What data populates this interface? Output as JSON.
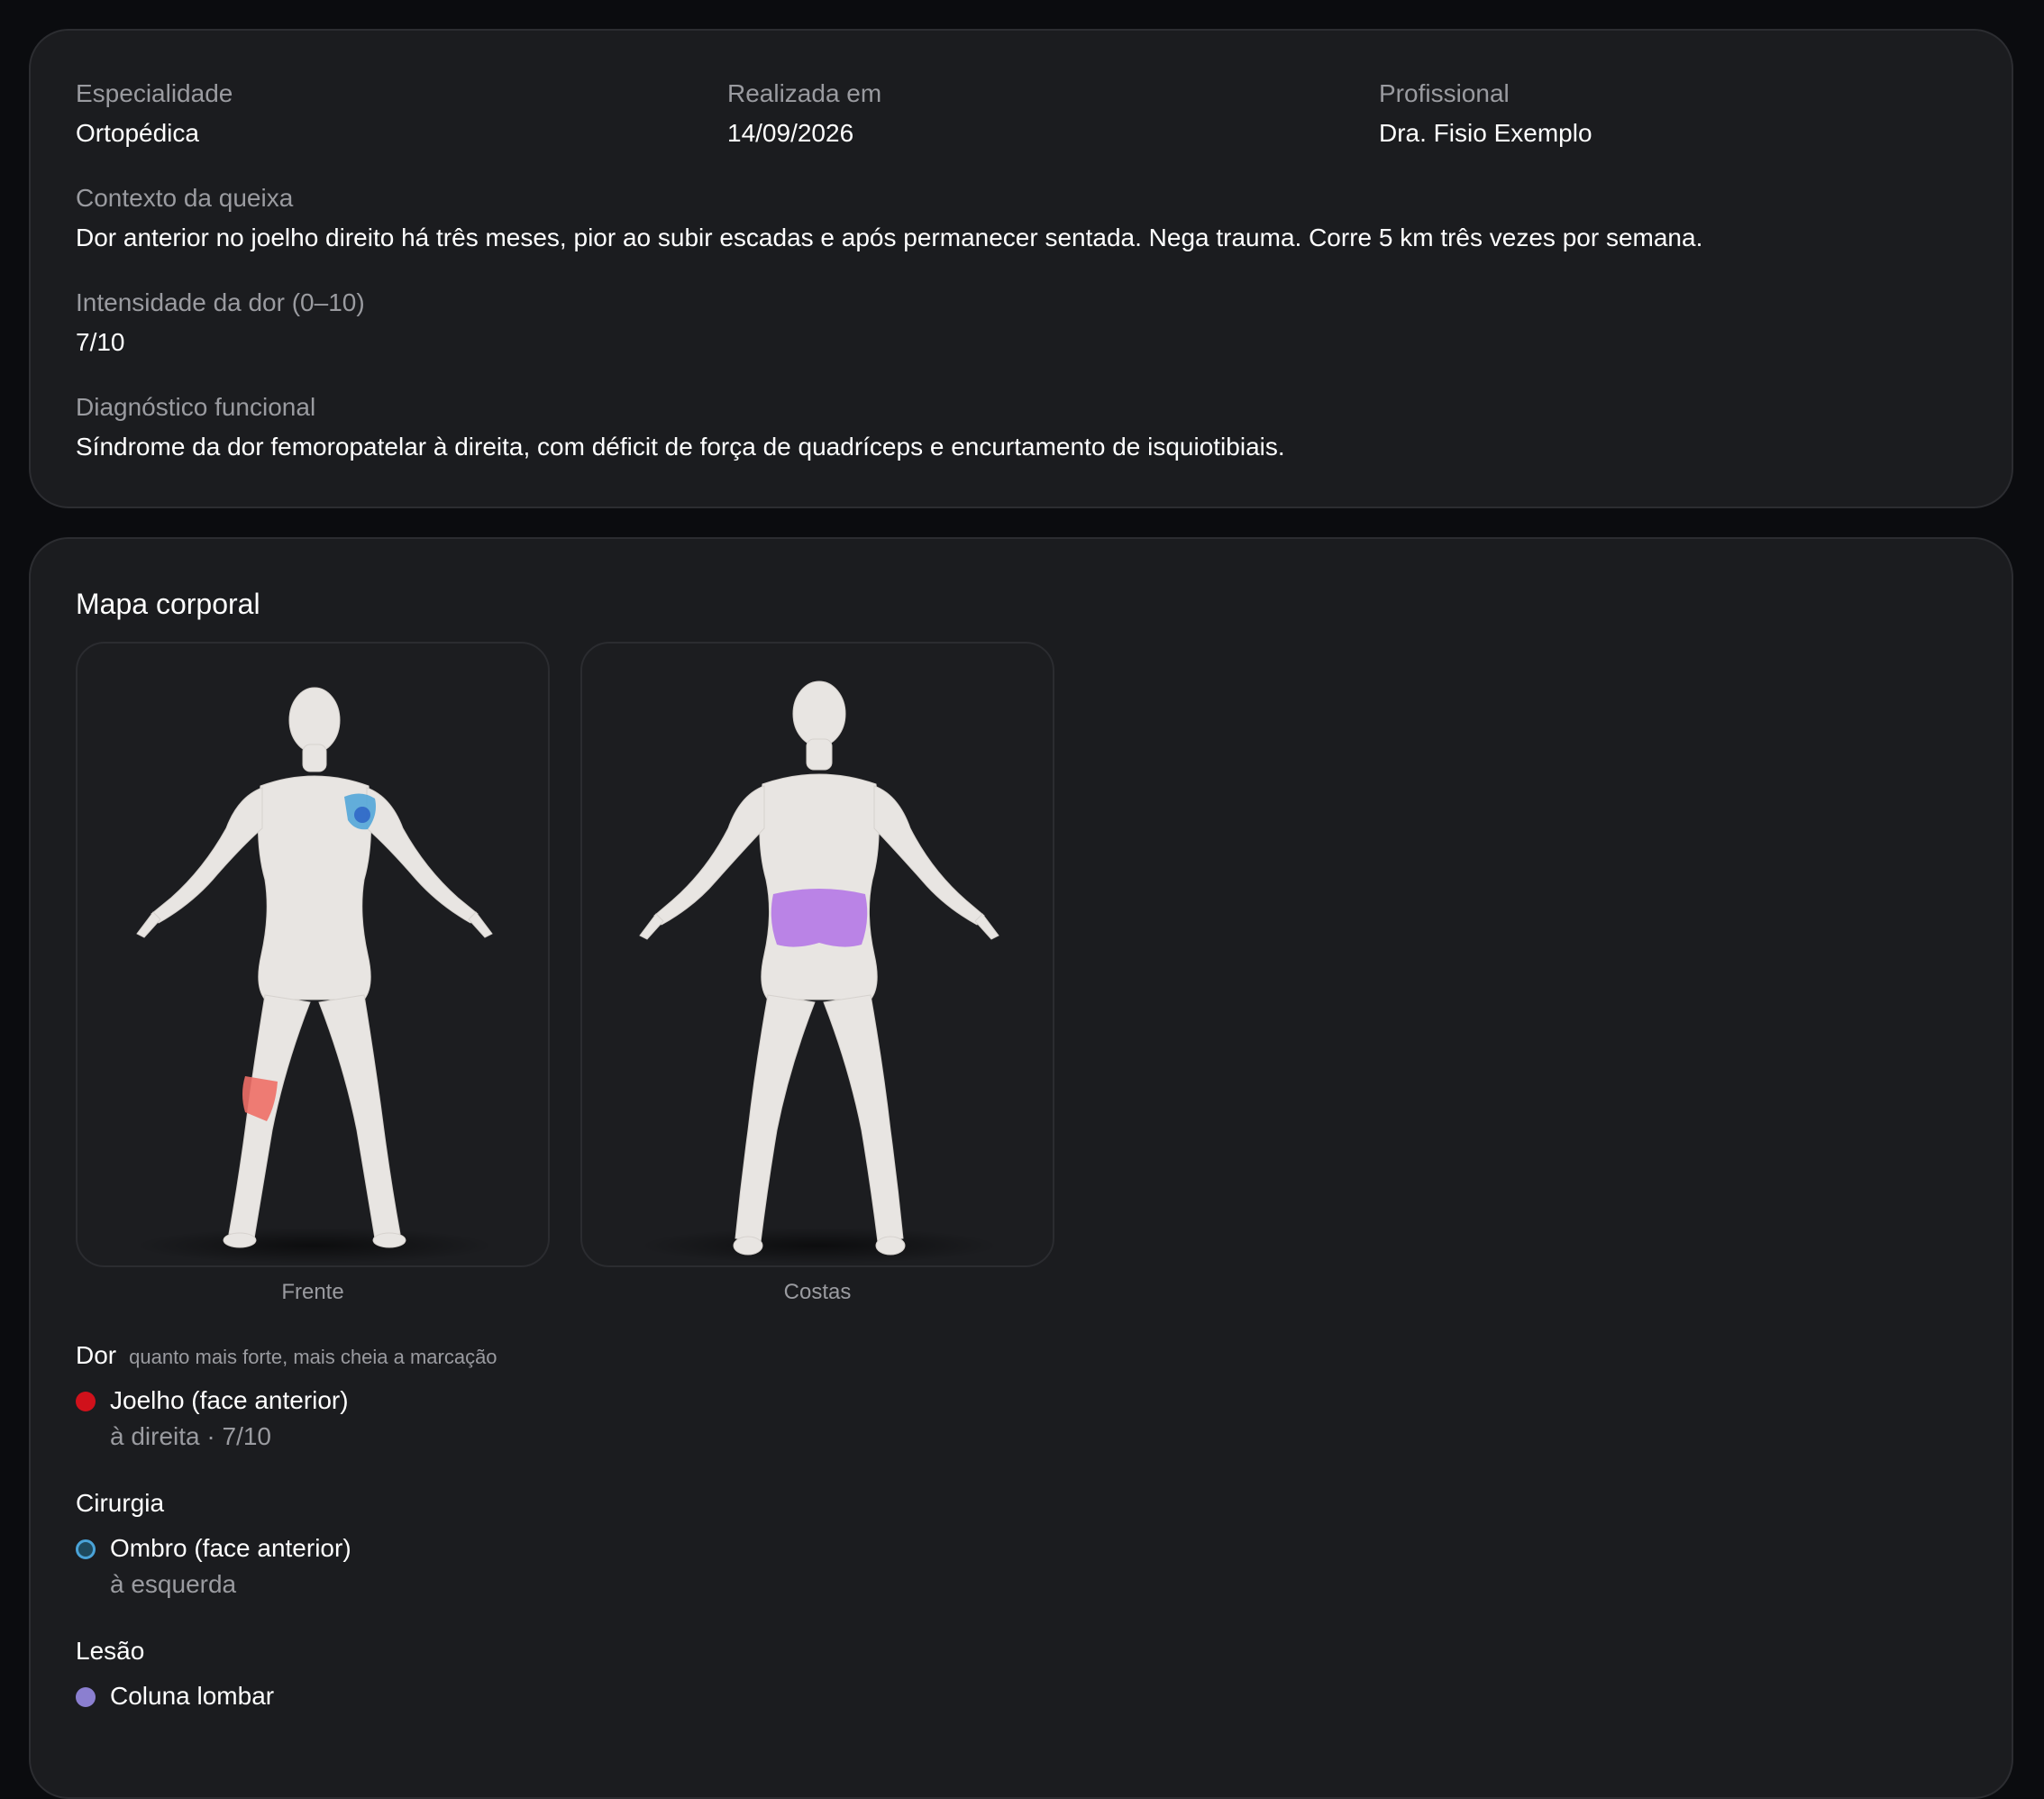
{
  "summary": {
    "especialidade": {
      "label": "Especialidade",
      "value": "Ortopédica"
    },
    "realizada": {
      "label": "Realizada em",
      "value": "14/09/2026"
    },
    "profissional": {
      "label": "Profissional",
      "value": "Dra. Fisio Exemplo"
    },
    "contexto": {
      "label": "Contexto da queixa",
      "value": "Dor anterior no joelho direito há três meses, pior ao subir escadas e após permanecer sentada. Nega trauma. Corre 5 km três vezes por semana."
    },
    "intensidade": {
      "label": "Intensidade da dor (0–10)",
      "value": "7/10"
    },
    "diagnostico": {
      "label": "Diagnóstico funcional",
      "value": "Síndrome da dor femoropatelar à direita, com déficit de força de quadríceps e encurtamento de isquiotibiais."
    }
  },
  "body_map": {
    "title": "Mapa corporal",
    "views": [
      {
        "caption": "Frente"
      },
      {
        "caption": "Costas"
      }
    ],
    "groups": {
      "dor": {
        "title": "Dor",
        "hint": "quanto mais forte, mais cheia a marcação",
        "color": "#d0111b",
        "items": [
          {
            "name": "Joelho (face anterior)",
            "detail": "à direita · 7/10"
          }
        ]
      },
      "cirurgia": {
        "title": "Cirurgia",
        "color": "#4aa3d8",
        "items": [
          {
            "name": "Ombro (face anterior)",
            "detail": "à esquerda"
          }
        ]
      },
      "lesao": {
        "title": "Lesão",
        "color": "#8b7fd0",
        "items": [
          {
            "name": "Coluna lombar"
          }
        ]
      }
    }
  }
}
